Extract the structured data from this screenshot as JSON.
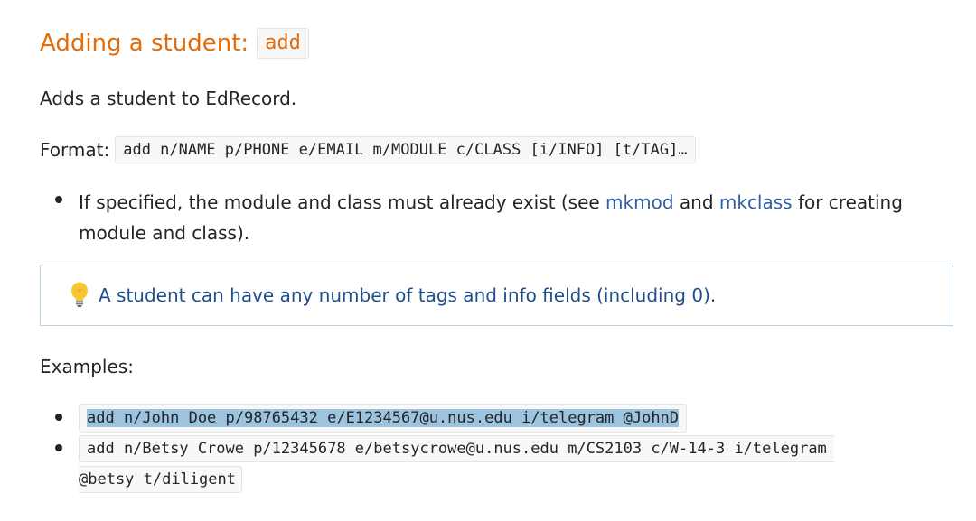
{
  "heading": {
    "text": "Adding a student:",
    "command": "add"
  },
  "description": "Adds a student to EdRecord.",
  "format": {
    "label": "Format:",
    "code": "add n/NAME p/PHONE e/EMAIL m/MODULE c/CLASS [i/INFO] [t/TAG]…"
  },
  "note": {
    "before": "If specified, the module and class must already exist (see ",
    "link1": "mkmod",
    "middle": " and ",
    "link2": "mkclass",
    "after": " for creating module and class)."
  },
  "tip": {
    "icon": "lightbulb-icon",
    "text": "A student can have any number of tags and info fields (including 0)."
  },
  "examples": {
    "label": "Examples:",
    "items": [
      "add n/John Doe p/98765432 e/E1234567@u.nus.edu i/telegram @JohnD",
      "add n/Betsy Crowe p/12345678 e/betsycrowe@u.nus.edu m/CS2103 c/W-14-3 i/telegram",
      "@betsy t/diligent"
    ]
  },
  "colors": {
    "heading": "#e46c0a",
    "link": "#2f5ea6",
    "tip_text": "#1f4e8c",
    "tip_border": "#b8d3e6",
    "selection": "#9cc4de"
  }
}
